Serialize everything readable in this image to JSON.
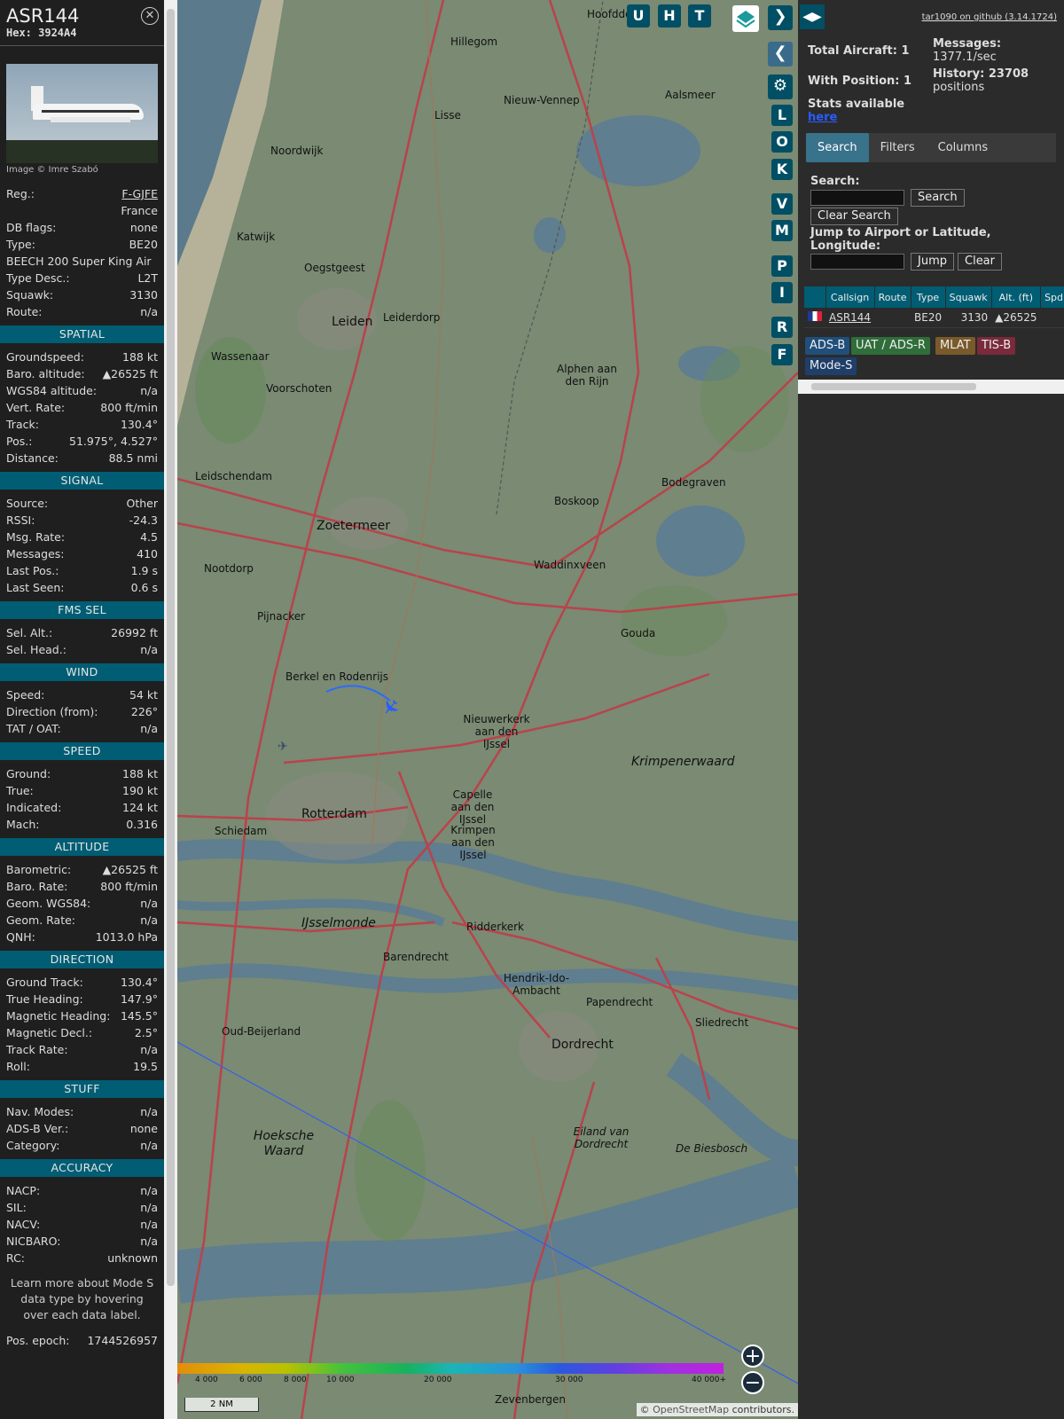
{
  "aircraft": {
    "callsign": "ASR144",
    "hex": "Hex: 3924A4",
    "photo_credit": "Image © Imre Szabó"
  },
  "details": [
    {
      "label": "Reg.:",
      "value": "F-GJFE",
      "link": true
    },
    {
      "label": "",
      "value": "France"
    },
    {
      "label": "DB flags:",
      "value": "none"
    },
    {
      "label": "Type:",
      "value": "BE20"
    },
    {
      "full": "BEECH 200 Super King Air"
    },
    {
      "label": "Type Desc.:",
      "value": "L2T"
    },
    {
      "label": "Squawk:",
      "value": "3130"
    },
    {
      "label": "Route:",
      "value": "n/a"
    }
  ],
  "sections": [
    {
      "title": "SPATIAL",
      "rows": [
        {
          "label": "Groundspeed:",
          "value": "188 kt"
        },
        {
          "label": "Baro. altitude:",
          "value": "▲26525 ft"
        },
        {
          "label": "WGS84 altitude:",
          "value": "n/a"
        },
        {
          "label": "Vert. Rate:",
          "value": "800 ft/min"
        },
        {
          "label": "Track:",
          "value": "130.4°"
        },
        {
          "label": "Pos.:",
          "value": "51.975°, 4.527°"
        },
        {
          "label": "Distance:",
          "value": "88.5 nmi"
        }
      ]
    },
    {
      "title": "SIGNAL",
      "rows": [
        {
          "label": "Source:",
          "value": "Other"
        },
        {
          "label": "RSSI:",
          "value": "-24.3"
        },
        {
          "label": "Msg. Rate:",
          "value": "4.5"
        },
        {
          "label": "Messages:",
          "value": "410"
        },
        {
          "label": "Last Pos.:",
          "value": "1.9 s"
        },
        {
          "label": "Last Seen:",
          "value": "0.6 s"
        }
      ]
    },
    {
      "title": "FMS SEL",
      "rows": [
        {
          "label": "Sel. Alt.:",
          "value": "26992 ft"
        },
        {
          "label": "Sel. Head.:",
          "value": "n/a"
        }
      ]
    },
    {
      "title": "WIND",
      "rows": [
        {
          "label": "Speed:",
          "value": "54 kt"
        },
        {
          "label": "Direction (from):",
          "value": "226°"
        },
        {
          "label": "TAT / OAT:",
          "value": "n/a"
        }
      ]
    },
    {
      "title": "SPEED",
      "rows": [
        {
          "label": "Ground:",
          "value": "188 kt"
        },
        {
          "label": "True:",
          "value": "190 kt"
        },
        {
          "label": "Indicated:",
          "value": "124 kt"
        },
        {
          "label": "Mach:",
          "value": "0.316"
        }
      ]
    },
    {
      "title": "ALTITUDE",
      "rows": [
        {
          "label": "Barometric:",
          "value": "▲26525 ft"
        },
        {
          "label": "Baro. Rate:",
          "value": "800 ft/min"
        },
        {
          "label": "Geom. WGS84:",
          "value": "n/a"
        },
        {
          "label": "Geom. Rate:",
          "value": "n/a"
        },
        {
          "label": "QNH:",
          "value": "1013.0 hPa"
        }
      ]
    },
    {
      "title": "DIRECTION",
      "rows": [
        {
          "label": "Ground Track:",
          "value": "130.4°"
        },
        {
          "label": "True Heading:",
          "value": "147.9°"
        },
        {
          "label": "Magnetic Heading:",
          "value": "145.5°"
        },
        {
          "label": "Magnetic Decl.:",
          "value": "2.5°"
        },
        {
          "label": "Track Rate:",
          "value": "n/a"
        },
        {
          "label": "Roll:",
          "value": "19.5"
        }
      ]
    },
    {
      "title": "STUFF",
      "rows": [
        {
          "label": "Nav. Modes:",
          "value": "n/a"
        },
        {
          "label": "ADS-B Ver.:",
          "value": "none"
        },
        {
          "label": "Category:",
          "value": "n/a"
        }
      ]
    },
    {
      "title": "ACCURACY",
      "rows": [
        {
          "label": "NACP:",
          "value": "n/a"
        },
        {
          "label": "SIL:",
          "value": "n/a"
        },
        {
          "label": "NACV:",
          "value": "n/a"
        },
        {
          "label": "NICBARO:",
          "value": "n/a"
        },
        {
          "label": "RC:",
          "value": "unknown"
        }
      ]
    }
  ],
  "note": "Learn more about Mode S data type by hovering over each data label.",
  "pos_epoch": {
    "label": "Pos. epoch:",
    "value": "1744526957"
  },
  "map": {
    "buttons": [
      "U",
      "H",
      "T"
    ],
    "side_buttons": [
      "L",
      "O",
      "K",
      "V",
      "M",
      "P",
      "I",
      "R",
      "F"
    ],
    "zoom_in": "+",
    "zoom_out": "−",
    "places": [
      {
        "name": "Hillegom"
      },
      {
        "name": "Hoofddorp"
      },
      {
        "name": "Nieuw-Vennep"
      },
      {
        "name": "Aalsmeer"
      },
      {
        "name": "Lisse"
      },
      {
        "name": "Noordwijk"
      },
      {
        "name": "Katwijk"
      },
      {
        "name": "Oegstgeest"
      },
      {
        "name": "Leiden"
      },
      {
        "name": "Leiderdorp"
      },
      {
        "name": "Wassenaar"
      },
      {
        "name": "Voorschoten"
      },
      {
        "name": "Alphen aan den Rijn"
      },
      {
        "name": "Leidschendam"
      },
      {
        "name": "Zoetermeer"
      },
      {
        "name": "Boskoop"
      },
      {
        "name": "Bodegraven"
      },
      {
        "name": "Waddinxveen"
      },
      {
        "name": "Nootdorp"
      },
      {
        "name": "Pijnacker"
      },
      {
        "name": "Gouda"
      },
      {
        "name": "Berkel en Rodenrijs"
      },
      {
        "name": "Nieuwerkerk aan den IJssel"
      },
      {
        "name": "Krimpenerwaard"
      },
      {
        "name": "Rotterdam"
      },
      {
        "name": "Schiedam"
      },
      {
        "name": "Capelle aan den IJssel"
      },
      {
        "name": "Krimpen aan den IJssel"
      },
      {
        "name": "IJsselmonde"
      },
      {
        "name": "Ridderkerk"
      },
      {
        "name": "Barendrecht"
      },
      {
        "name": "Hendrik-Ido-Ambacht"
      },
      {
        "name": "Papendrecht"
      },
      {
        "name": "Sliedrecht"
      },
      {
        "name": "Oud-Beijerland"
      },
      {
        "name": "Dordrecht"
      },
      {
        "name": "Hoeksche Waard"
      },
      {
        "name": "Eiland van Dordrecht"
      },
      {
        "name": "De Biesbosch"
      },
      {
        "name": "Zevenbergen"
      }
    ],
    "colorbar_ticks": [
      "4 000",
      "6 000",
      "8 000",
      "10 000",
      "20 000",
      "30 000",
      "40 000+"
    ],
    "scale": "2 NM",
    "attribution_prefix": "© ",
    "attribution_link": "OpenStreetMap",
    "attribution_suffix": " contributors."
  },
  "panel": {
    "github": "tar1090 on github (3.14.1724)",
    "total_aircraft": "Total Aircraft: 1",
    "with_position": "With Position: 1",
    "stats_label": "Stats available",
    "stats_link": "here",
    "messages_label": "Messages:",
    "messages_value": "1377.1/sec",
    "history_label": "History: 23708",
    "history_value": "positions",
    "tabs": [
      "Search",
      "Filters",
      "Columns"
    ],
    "search_label": "Search:",
    "search_btn": "Search",
    "clear_search_btn": "Clear Search",
    "jump_label": "Jump to Airport or Latitude, Longitude:",
    "jump_btn": "Jump",
    "clear_btn": "Clear",
    "table_headers": [
      "Callsign",
      "Route",
      "Type",
      "Squawk",
      "Alt. (ft)",
      "Spd"
    ],
    "table_rows": [
      {
        "callsign": "ASR144",
        "route": "",
        "type": "BE20",
        "squawk": "3130",
        "alt": "▲26525"
      }
    ],
    "sources": [
      {
        "name": "ADS-B",
        "color": "#1f4f7a"
      },
      {
        "name": "UAT / ADS-R",
        "color": "#2f6e3a"
      },
      {
        "name": "MLAT",
        "color": "#7a5a2a"
      },
      {
        "name": "TIS-B",
        "color": "#7a2a3a"
      },
      {
        "name": "Mode-S",
        "color": "#1f3f6a"
      }
    ]
  }
}
